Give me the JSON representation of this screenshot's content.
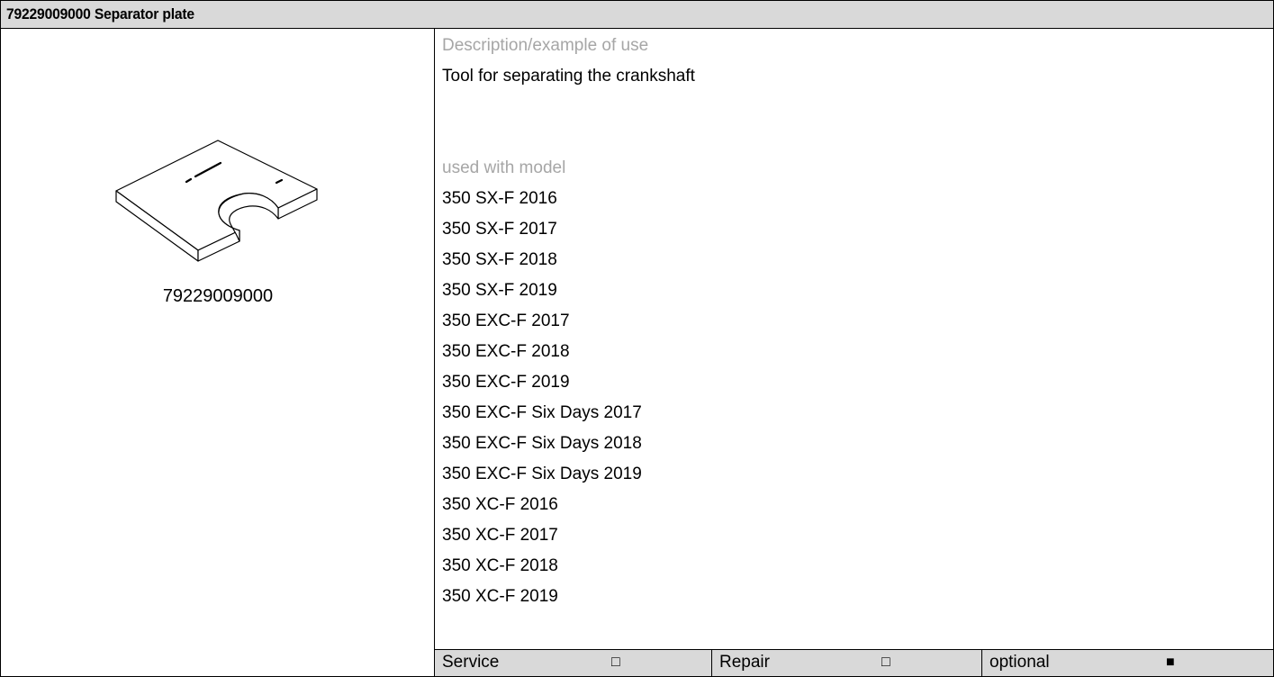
{
  "header": {
    "title": "79229009000 Separator plate"
  },
  "figure": {
    "part_number": "79229009000"
  },
  "description": {
    "heading": "Description/example of use",
    "text": "Tool for separating the crankshaft"
  },
  "models": {
    "heading": "used with model",
    "items": [
      "350 SX-F 2016",
      "350 SX-F 2017",
      "350 SX-F 2018",
      "350 SX-F 2019",
      "350 EXC-F 2017",
      "350 EXC-F 2018",
      "350 EXC-F 2019",
      "350 EXC-F Six Days 2017",
      "350 EXC-F Six Days 2018",
      "350 EXC-F Six Days 2019",
      "350 XC-F 2016",
      "350 XC-F 2017",
      "350 XC-F 2018",
      "350 XC-F 2019"
    ]
  },
  "footer": {
    "service": {
      "label": "Service",
      "mark": "□"
    },
    "repair": {
      "label": "Repair",
      "mark": "□"
    },
    "optional": {
      "label": "optional",
      "mark": "■"
    }
  }
}
